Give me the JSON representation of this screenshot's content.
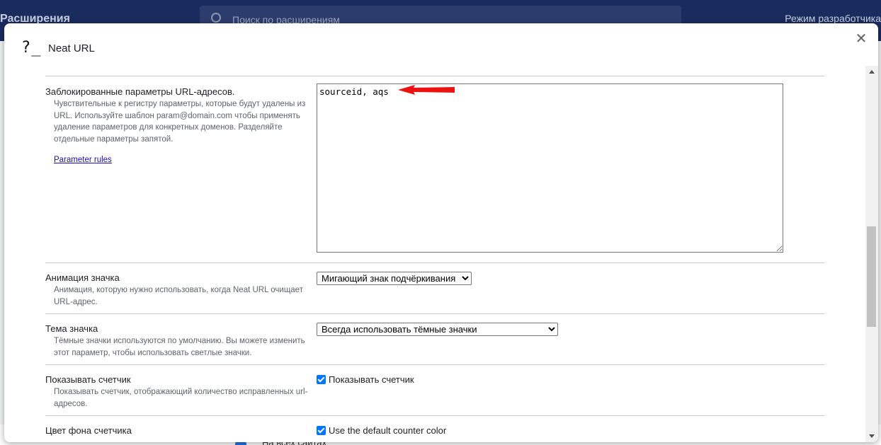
{
  "background": {
    "page_title": "Расширения",
    "search_placeholder": "Поиск по расширениям",
    "dev_mode_label": "Режим разработчика",
    "bottom_text": "На всех сайтах"
  },
  "dialog": {
    "icon_text": "?_",
    "title": "Neat URL",
    "close_icon": "close-icon"
  },
  "settings": {
    "blocked_params": {
      "title": "Заблокированные параметры URL-адресов.",
      "description": "Чувствительные к регистру параметры, которые будут удалены из URL. Используйте шаблон param@domain.com чтобы применять удаление параметров для конкретных доменов. Разделяйте отдельные параметры запятой.",
      "link": "Parameter rules",
      "value": "sourceid, aqs"
    },
    "icon_animation": {
      "title": "Анимация значка",
      "description": "Анимация, которую нужно использовать, когда Neat URL очищает URL-адрес.",
      "selected": "Мигающий знак подчёркивания"
    },
    "icon_theme": {
      "title": "Тема значка",
      "description": "Тёмные значки используются по умолчанию. Вы можете изменить этот параметр, чтобы использовать светлые значки.",
      "selected": "Всегда использовать тёмные значки"
    },
    "show_counter": {
      "title": "Показывать счетчик",
      "description": "Показывать счетчик, отображающий количество исправленных url-адресов.",
      "checkbox_label": "Показывать счетчик",
      "checked": true
    },
    "counter_color": {
      "title": "Цвет фона счетчика",
      "checkbox_label": "Use the default counter color",
      "checked": true
    }
  },
  "colors": {
    "header_bg": "#1a2b5e",
    "arrow": "#ee1111",
    "checkbox": "#0075ff"
  }
}
